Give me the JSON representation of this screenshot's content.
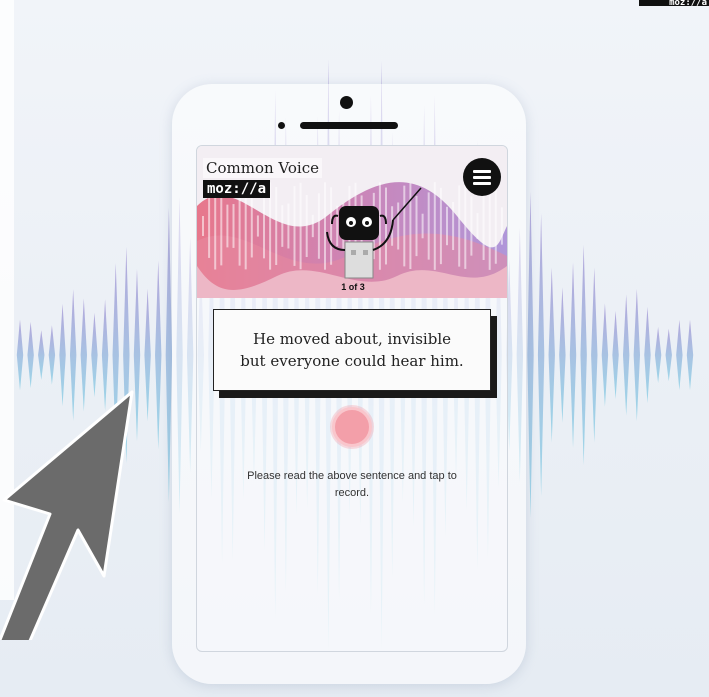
{
  "app": {
    "brand_title": "Common Voice",
    "brand_logo": "moz://a"
  },
  "header": {
    "menu_icon": "hamburger-menu-icon",
    "counter": "1 of 3"
  },
  "prompt": {
    "sentence": "He moved about, invisible but everyone could hear him.",
    "record_icon": "record-icon",
    "instruction": "Please read the above sentence and tap to record."
  },
  "colors": {
    "wave_purple": "#a99ad6",
    "wave_blue": "#8fd2e6",
    "record_pink": "#f39fa9",
    "hero_pink": "#e66a80",
    "hero_purple": "#a88cd6",
    "arrow_gray": "#6b6b6b"
  },
  "overlay": {
    "arrow_icon": "pointer-arrow-icon",
    "corner_logo": "moz://a"
  }
}
